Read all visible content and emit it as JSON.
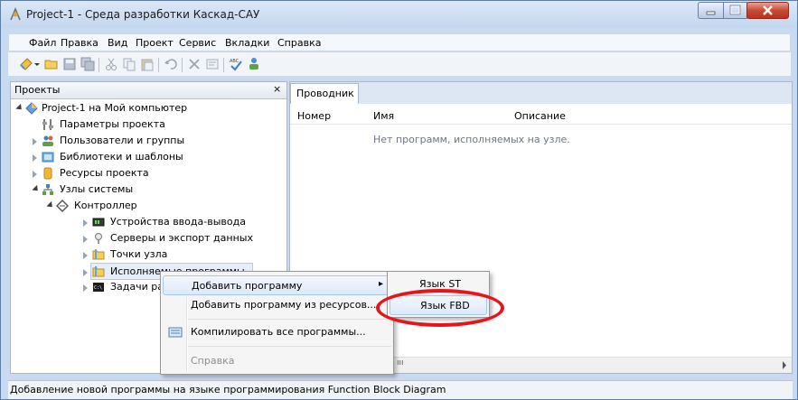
{
  "window": {
    "title": "Project-1 - Среда разработки Каскад-САУ"
  },
  "menu": [
    {
      "label": "Файл"
    },
    {
      "label": "Правка"
    },
    {
      "label": "Вид"
    },
    {
      "label": "Проект"
    },
    {
      "label": "Сервис"
    },
    {
      "label": "Вкладки"
    },
    {
      "label": "Справка"
    }
  ],
  "projects_panel": {
    "title": "Проекты",
    "close_glyph": "×",
    "tree": [
      {
        "label": "Project-1 на Мой компьютер",
        "icon": "project-icon"
      },
      {
        "label": "Параметры проекта",
        "icon": "parameters-icon"
      },
      {
        "label": "Пользователи и группы",
        "icon": "users-icon"
      },
      {
        "label": "Библиотеки и шаблоны",
        "icon": "libraries-icon"
      },
      {
        "label": "Ресурсы проекта",
        "icon": "resources-icon"
      },
      {
        "label": "Узлы системы",
        "icon": "nodes-icon"
      },
      {
        "label": "Контроллер",
        "icon": "controller-icon"
      },
      {
        "label": "Устройства ввода-вывода",
        "icon": "io-devices-icon"
      },
      {
        "label": "Серверы и экспорт данных",
        "icon": "servers-icon"
      },
      {
        "label": "Точки узла",
        "icon": "folder-icon"
      },
      {
        "label": "Исполняемые программы",
        "icon": "folder-icon"
      },
      {
        "label": "Задачи ра",
        "icon": "console-icon"
      }
    ]
  },
  "explorer": {
    "tab": "Проводник",
    "columns": [
      "Номер",
      "Имя",
      "Описание"
    ],
    "empty_message": "Нет программ, исполняемых на узле.",
    "scroll_glyph": "ııı"
  },
  "context_menu": {
    "items": [
      {
        "label": "Добавить программу",
        "has_submenu": true,
        "submenu_arrow": "▸"
      },
      {
        "label": "Добавить программу из ресурсов..."
      },
      {
        "label": "Компилировать все программы...",
        "icon": "compile-icon"
      },
      {
        "label": "Справка",
        "disabled": true
      }
    ]
  },
  "submenu": {
    "items": [
      {
        "label": "Язык ST"
      },
      {
        "label": "Язык FBD"
      }
    ]
  },
  "status_bar": {
    "text": "Добавление новой программы на языке программирования Function Block Diagram"
  },
  "colors": {
    "highlight_ellipse": "#e8141b",
    "close_button": "#c84b36"
  }
}
